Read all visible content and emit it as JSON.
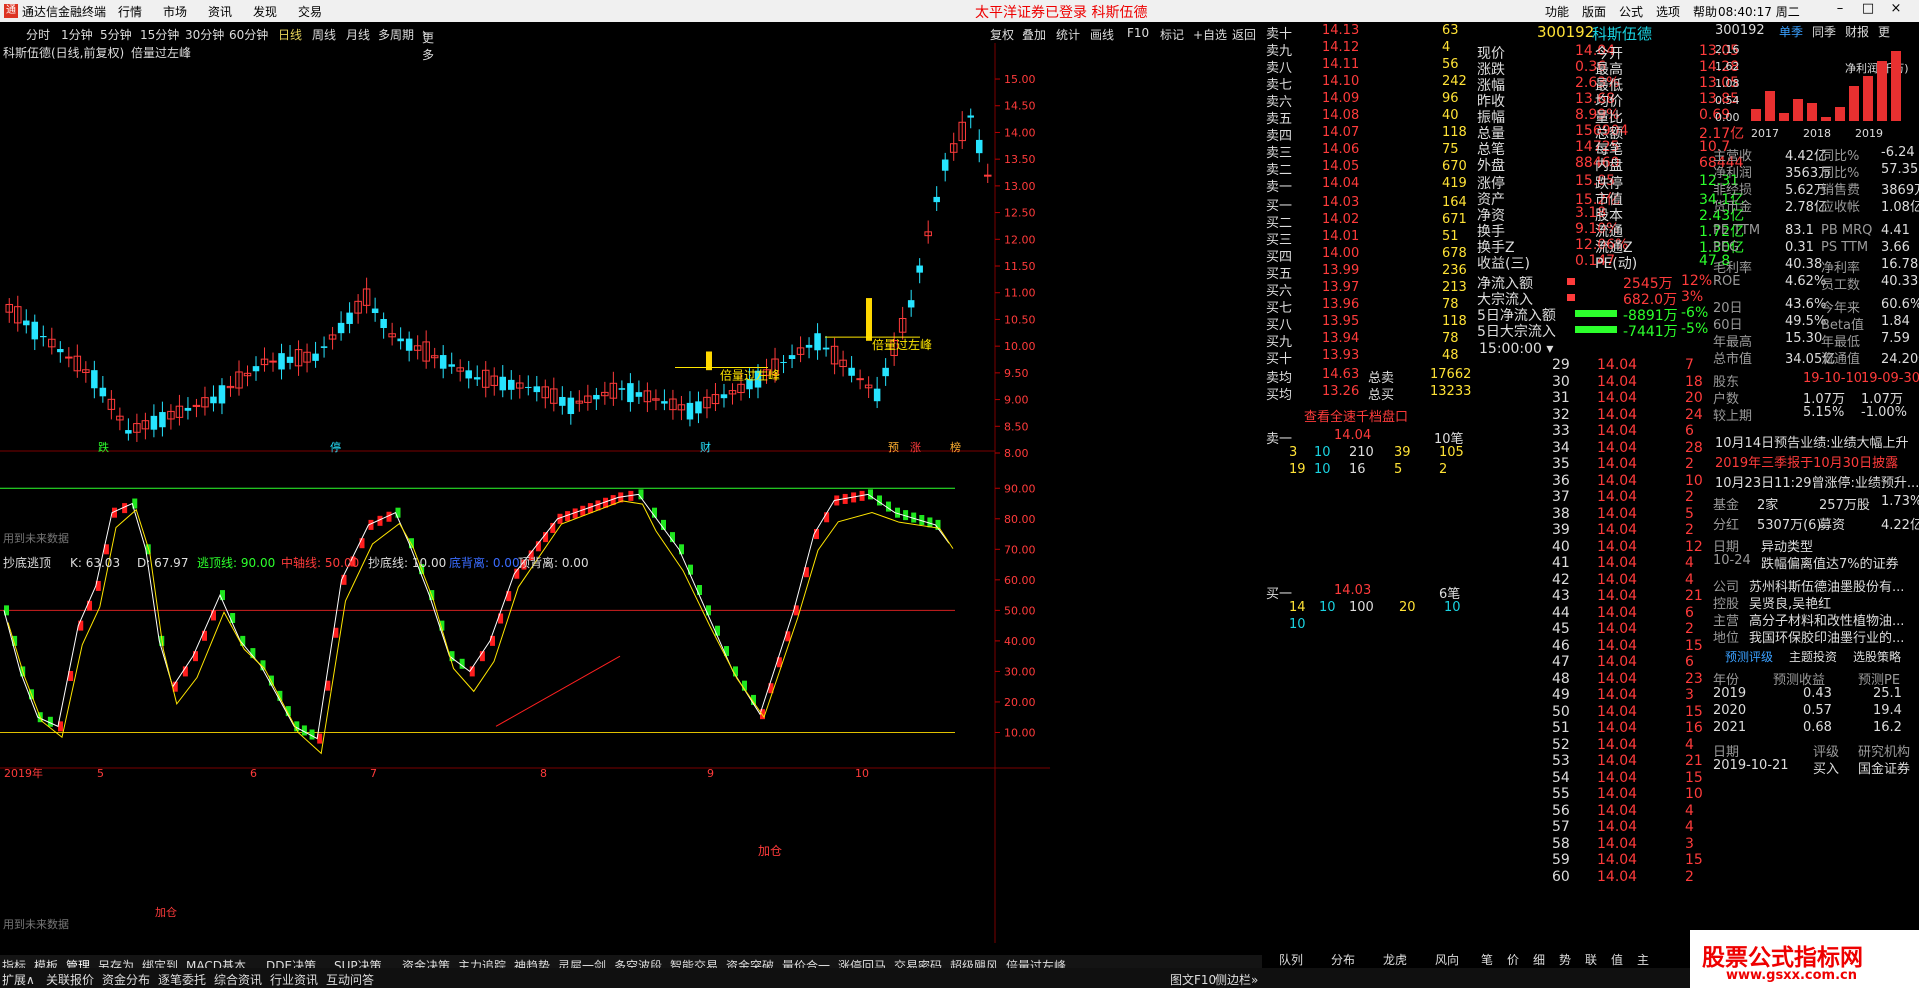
{
  "app": {
    "title": "通达信金融终端",
    "menus": [
      "行情",
      "市场",
      "资讯",
      "发现",
      "交易"
    ],
    "notice": "太平洋证券已登录 科斯伍德",
    "right_menus": [
      "功能",
      "版面",
      "公式",
      "选项",
      "帮助"
    ],
    "time": "08:40:17",
    "weekday": "周二"
  },
  "periods": [
    "分时",
    "1分钟",
    "5分钟",
    "15分钟",
    "30分钟",
    "60分钟",
    "日线",
    "周线",
    "月线",
    "多周期",
    "更多"
  ],
  "period_selected": "日线",
  "toolbar": [
    "复权",
    "叠加",
    "统计",
    "画线",
    "F10",
    "标记",
    "+自选",
    "返回"
  ],
  "chart": {
    "header": "科斯伍德(日线,前复权)",
    "indicator_name": "倍量过左峰",
    "price_axis": [
      "15.00",
      "14.50",
      "14.00",
      "13.50",
      "13.00",
      "12.50",
      "12.00",
      "11.50",
      "11.00",
      "10.50",
      "10.00",
      "9.50",
      "9.00",
      "8.50",
      "8.00"
    ],
    "future_note": "用到未来数据",
    "future_note2": "用到未来数据",
    "annot1": "倍量过左峰",
    "annot2": "倍量过左峰",
    "event_labels": [
      "跌",
      "停",
      "财",
      "预",
      "涨",
      "榜"
    ],
    "ind": {
      "name": "抄底逃顶",
      "k": "K: 63.03",
      "d": "D: 67.97",
      "top": "逃顶线: 90.00",
      "mid": "中轴线: 50.00",
      "bottom": "抄底线: 10.00",
      "div": "底背离: 0.00",
      "div2": "顶背离: 0.00",
      "axis": [
        "90.00",
        "80.00",
        "70.00",
        "60.00",
        "50.00",
        "40.00",
        "30.00",
        "20.00",
        "10.00"
      ],
      "add": "加仓",
      "add2": "加仓"
    },
    "dates": [
      "2019年",
      "5",
      "6",
      "7",
      "8",
      "9",
      "10"
    ],
    "period_label": "日线"
  },
  "chart_data": {
    "type": "candlestick",
    "price_range": [
      8.0,
      15.3
    ],
    "ind_range": [
      0,
      95
    ]
  },
  "quote": {
    "code": "300192",
    "name": "科斯伍德",
    "asks": [
      [
        "卖十",
        "14.13",
        "63"
      ],
      [
        "卖九",
        "14.12",
        "4"
      ],
      [
        "卖八",
        "14.11",
        "56"
      ],
      [
        "卖七",
        "14.10",
        "242"
      ],
      [
        "卖六",
        "14.09",
        "96"
      ],
      [
        "卖五",
        "14.08",
        "40"
      ],
      [
        "卖四",
        "14.07",
        "118"
      ],
      [
        "卖三",
        "14.06",
        "75"
      ],
      [
        "卖二",
        "14.05",
        "670"
      ],
      [
        "卖一",
        "14.04",
        "419"
      ]
    ],
    "bids": [
      [
        "买一",
        "14.03",
        "164"
      ],
      [
        "买二",
        "14.02",
        "671"
      ],
      [
        "买三",
        "14.01",
        "51"
      ],
      [
        "买四",
        "14.00",
        "678"
      ],
      [
        "买五",
        "13.99",
        "236"
      ],
      [
        "买六",
        "13.97",
        "213"
      ],
      [
        "买七",
        "13.96",
        "78"
      ],
      [
        "买八",
        "13.95",
        "118"
      ],
      [
        "买九",
        "13.94",
        "78"
      ],
      [
        "买十",
        "13.93",
        "48"
      ]
    ],
    "avg": [
      [
        "卖均",
        "14.63",
        "总卖",
        "17662"
      ],
      [
        "买均",
        "13.26",
        "总买",
        "13233"
      ]
    ],
    "level_link": "查看全速千档盘口",
    "sell1": {
      "label": "卖一",
      "price": "14.04",
      "cnt": "10笔",
      "q1": [
        "3",
        "10",
        "210",
        "39",
        "105"
      ],
      "q2": [
        "19",
        "10",
        "16",
        "5",
        "2"
      ]
    },
    "buy1": {
      "label": "买一",
      "price": "14.03",
      "cnt": "6笔",
      "q1": [
        "14",
        "10",
        "100",
        "20",
        "10"
      ],
      "q2": [
        "10"
      ]
    }
  },
  "stats": [
    [
      "现价",
      "14.04",
      "今开",
      "13.05"
    ],
    [
      "涨跌",
      "0.36",
      "最高",
      "14.28"
    ],
    [
      "涨幅",
      "2.63%",
      "最低",
      "13.05"
    ],
    [
      "昨收",
      "13.68",
      "均价",
      "13.85"
    ],
    [
      "振幅",
      "8.99%",
      "量比",
      "0.69"
    ],
    [
      "总量",
      "156904",
      "总额",
      "2.17亿"
    ],
    [
      "总笔",
      "14725",
      "每笔",
      "10.7"
    ],
    [
      "外盘",
      "88460",
      "内盘",
      "68444"
    ]
  ],
  "stats2": [
    [
      "涨停",
      "15.05",
      "跌停",
      "12.31"
    ],
    [
      "资产",
      "15.2亿",
      "市值",
      "34.1亿"
    ],
    [
      "净资",
      "3.18",
      "股本",
      "2.43亿"
    ],
    [
      "换手",
      "9.10%",
      "流通",
      "1.72亿"
    ],
    [
      "换手Z",
      "12.06%",
      "流通Z",
      "1.30亿"
    ],
    [
      "收益(三)",
      "0.147",
      "PE(动)",
      "47.8"
    ]
  ],
  "flow": [
    [
      "净流入额",
      "2545万",
      "12%"
    ],
    [
      "大宗流入",
      "682.0万",
      "3%"
    ],
    [
      "5日净流入额",
      "-8891万",
      "-6%"
    ],
    [
      "5日大宗流入",
      "-7441万",
      "-5%"
    ]
  ],
  "ticks": {
    "time": "15:00:00",
    "rows": [
      [
        "29",
        "14.04",
        "7"
      ],
      [
        "30",
        "14.04",
        "18"
      ],
      [
        "31",
        "14.04",
        "20"
      ],
      [
        "32",
        "14.04",
        "24"
      ],
      [
        "33",
        "14.04",
        "6"
      ],
      [
        "34",
        "14.04",
        "28"
      ],
      [
        "35",
        "14.04",
        "2"
      ],
      [
        "36",
        "14.04",
        "10"
      ],
      [
        "37",
        "14.04",
        "2"
      ],
      [
        "38",
        "14.04",
        "5"
      ],
      [
        "39",
        "14.04",
        "2"
      ],
      [
        "40",
        "14.04",
        "12"
      ],
      [
        "41",
        "14.04",
        "4"
      ],
      [
        "42",
        "14.04",
        "4"
      ],
      [
        "43",
        "14.04",
        "21"
      ],
      [
        "44",
        "14.04",
        "6"
      ],
      [
        "45",
        "14.04",
        "2"
      ],
      [
        "46",
        "14.04",
        "15"
      ],
      [
        "47",
        "14.04",
        "6"
      ],
      [
        "48",
        "14.04",
        "23"
      ],
      [
        "49",
        "14.04",
        "3"
      ],
      [
        "50",
        "14.04",
        "15"
      ],
      [
        "51",
        "14.04",
        "16"
      ],
      [
        "52",
        "14.04",
        "4"
      ],
      [
        "53",
        "14.04",
        "21"
      ],
      [
        "54",
        "14.04",
        "15"
      ],
      [
        "55",
        "14.04",
        "10"
      ],
      [
        "56",
        "14.04",
        "4"
      ],
      [
        "57",
        "14.04",
        "4"
      ],
      [
        "58",
        "14.04",
        "3"
      ],
      [
        "59",
        "14.04",
        "15"
      ],
      [
        "60",
        "14.04",
        "2"
      ]
    ]
  },
  "f10": {
    "code": "300192",
    "tabs": [
      "单季",
      "同季",
      "财报",
      "更"
    ],
    "mini_axis": [
      "2.16",
      "1.62",
      "1.08",
      "0.54",
      "0.00"
    ],
    "mini_title": "净利润(千万)",
    "years": [
      "2017",
      "2018",
      "2019"
    ],
    "rows": [
      [
        "主营收",
        "4.42亿",
        "同比%",
        "-6.24"
      ],
      [
        "净利润",
        "3563万",
        "同比%",
        "57.35"
      ],
      [
        "非经损",
        "5.62万",
        "销售费",
        "3869万"
      ],
      [
        "货币金",
        "2.78亿",
        "应收帐",
        "1.08亿"
      ]
    ],
    "val": [
      [
        "PE TTM",
        "83.1",
        "PB MRQ",
        "4.41"
      ],
      [
        "PEG",
        "0.31",
        "PS TTM",
        "3.66"
      ],
      [
        "毛利率",
        "40.38",
        "净利率",
        "16.78"
      ],
      [
        "ROE",
        "4.62%",
        "员工数",
        "40.33"
      ]
    ],
    "perf": [
      [
        "20日",
        "43.6%",
        "今年来",
        "60.6%"
      ],
      [
        "60日",
        "49.5%",
        "Beta值",
        "1.84"
      ],
      [
        "年最高",
        "15.30",
        "年最低",
        "7.59"
      ],
      [
        "总市值",
        "34.05亿",
        "流通值",
        "24.20亿"
      ]
    ],
    "holder": [
      [
        "股东",
        "19-10-10",
        "19-09-30"
      ],
      [
        "户数",
        "1.07万",
        "1.07万"
      ],
      [
        "较上期",
        "5.15%",
        "-1.00%"
      ]
    ],
    "news": [
      "10月14日预告业绩:业绩大幅上升",
      "2019年三季报于10月30日披露",
      "10月23日11:29曾涨停:业绩预升..."
    ],
    "fund": [
      [
        "基金",
        "2家",
        "257万股",
        "1.73%"
      ],
      [
        "分红",
        "5307万(6)",
        "募资",
        "4.22亿(1)"
      ]
    ],
    "event": [
      [
        "日期",
        "异动类型"
      ],
      [
        "10-24",
        "跌幅偏离值达7%的证券"
      ]
    ],
    "company": [
      [
        "公司",
        "苏州科斯伍德油墨股份有..."
      ],
      [
        "控股",
        "吴贤良,吴艳红"
      ],
      [
        "主营",
        "高分子材料和改性植物油..."
      ],
      [
        "地位",
        "我国环保胶印油墨行业的..."
      ]
    ],
    "fc_tabs": [
      "预测评级",
      "主题投资",
      "选股策略"
    ],
    "fc_head": [
      "年份",
      "预测收益",
      "预测PE"
    ],
    "fc": [
      [
        "2019",
        "0.43",
        "25.1"
      ],
      [
        "2020",
        "0.57",
        "19.4"
      ],
      [
        "2021",
        "0.68",
        "16.2"
      ]
    ],
    "rating_head": [
      "日期",
      "评级",
      "研究机构"
    ],
    "rating": [
      "2019-10-21",
      "买入",
      "国金证券"
    ]
  },
  "bottom_tabs1": [
    "指标",
    "模板",
    "管理",
    "另存为",
    "绑定到",
    "MACD基本",
    "DDE决策",
    "SUP决策",
    "资金决策",
    "主力追踪",
    "神趋势",
    "灵犀一剑",
    "多空波段",
    "智能交易",
    "资金突破",
    "量价合一",
    "涨停回马",
    "交易密码",
    "超级飓风",
    "倍量过左峰"
  ],
  "bottom_tabs2": [
    "扩展∧",
    "关联报价",
    "资金分布",
    "逐笔委托",
    "综合资讯",
    "行业资讯",
    "互动问答"
  ],
  "bottom_right": [
    "图文F10",
    "侧边栏»"
  ],
  "panel_tabs": [
    "队列",
    "分布",
    "龙虎",
    "风向"
  ],
  "side_tabs": [
    "笔",
    "价",
    "细",
    "势",
    "联",
    "值",
    "主"
  ],
  "watermark": {
    "title": "股票公式指标网",
    "url": "www.gsxx.com.cn"
  }
}
